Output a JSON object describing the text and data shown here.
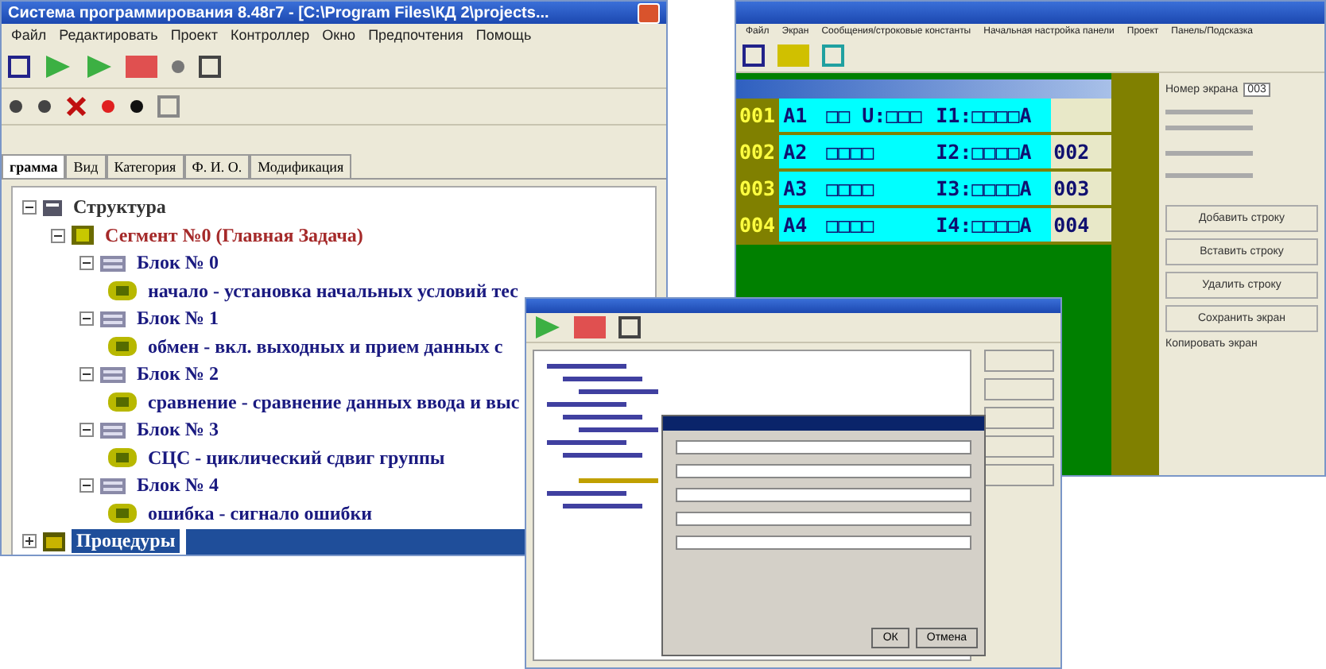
{
  "left_window": {
    "title": "Система программирования 8.48г7 - [C:\\Program Files\\КД 2\\projects...",
    "menu": [
      "Файл",
      "Редактировать",
      "Проект",
      "Контроллер",
      "Окно",
      "Предпочтения",
      "Помощь"
    ],
    "tabs": [
      {
        "label": "грамма",
        "selected": true
      },
      {
        "label": "Вид",
        "selected": false
      },
      {
        "label": "Категория",
        "selected": false
      },
      {
        "label": "Ф. И. О.",
        "selected": false
      },
      {
        "label": "Модификация",
        "selected": false
      }
    ],
    "tree": [
      {
        "label": "Структура",
        "kind": "root",
        "selected": false,
        "expanded": true,
        "children": [
          {
            "label": "Сегмент №0  (Главная Задача)",
            "kind": "segment",
            "selected": false,
            "expanded": true,
            "children": [
              {
                "label": "Блок № 0",
                "kind": "block",
                "selected": false,
                "expanded": true,
                "children": [
                  {
                    "label": "начало  - установка начальных условий тес",
                    "kind": "task",
                    "selected": false
                  }
                ]
              },
              {
                "label": "Блок № 1",
                "kind": "block",
                "selected": false,
                "expanded": true,
                "children": [
                  {
                    "label": "обмен  - вкл. выходных и прием данных с",
                    "kind": "task",
                    "selected": false
                  }
                ]
              },
              {
                "label": "Блок № 2",
                "kind": "block",
                "selected": false,
                "expanded": true,
                "children": [
                  {
                    "label": "сравнение  - сравнение данных ввода и выс",
                    "kind": "task",
                    "selected": false
                  }
                ]
              },
              {
                "label": "Блок № 3",
                "kind": "block",
                "selected": false,
                "expanded": true,
                "children": [
                  {
                    "label": "СЦС  - циклический сдвиг группы",
                    "kind": "task",
                    "selected": false
                  }
                ]
              },
              {
                "label": "Блок № 4",
                "kind": "block",
                "selected": false,
                "expanded": true,
                "children": [
                  {
                    "label": "ошибка  - сигнало ошибки",
                    "kind": "task",
                    "selected": false
                  }
                ]
              }
            ]
          }
        ]
      },
      {
        "label": "Процедуры",
        "kind": "folder",
        "selected": true,
        "expanded": false
      }
    ]
  },
  "right_window": {
    "menu": [
      "Файл",
      "Экран",
      "Сообщения/строковые константы",
      "Начальная настройка панели",
      "Проект",
      "Панель/Подсказка"
    ],
    "rows": [
      {
        "num": "001",
        "name": "A1",
        "field": "□□ U:□□□",
        "input": "I1:□□□□A"
      },
      {
        "num": "002",
        "name": "A2",
        "field": "□□□□",
        "input": "I2:□□□□A",
        "code": "002"
      },
      {
        "num": "003",
        "name": "A3",
        "field": "□□□□",
        "input": "I3:□□□□A",
        "code": "003"
      },
      {
        "num": "004",
        "name": "A4",
        "field": "□□□□",
        "input": "I4:□□□□A",
        "code": "004"
      }
    ],
    "screen_number": {
      "label": "Номер экрана",
      "value": "003"
    },
    "buttons": [
      "Добавить строку",
      "Вставить строку",
      "Удалить строку",
      "Сохранить экран"
    ],
    "copy_label": "Копировать экран"
  },
  "dialog": {
    "buttons": [
      "ОК",
      "Отмена"
    ]
  }
}
